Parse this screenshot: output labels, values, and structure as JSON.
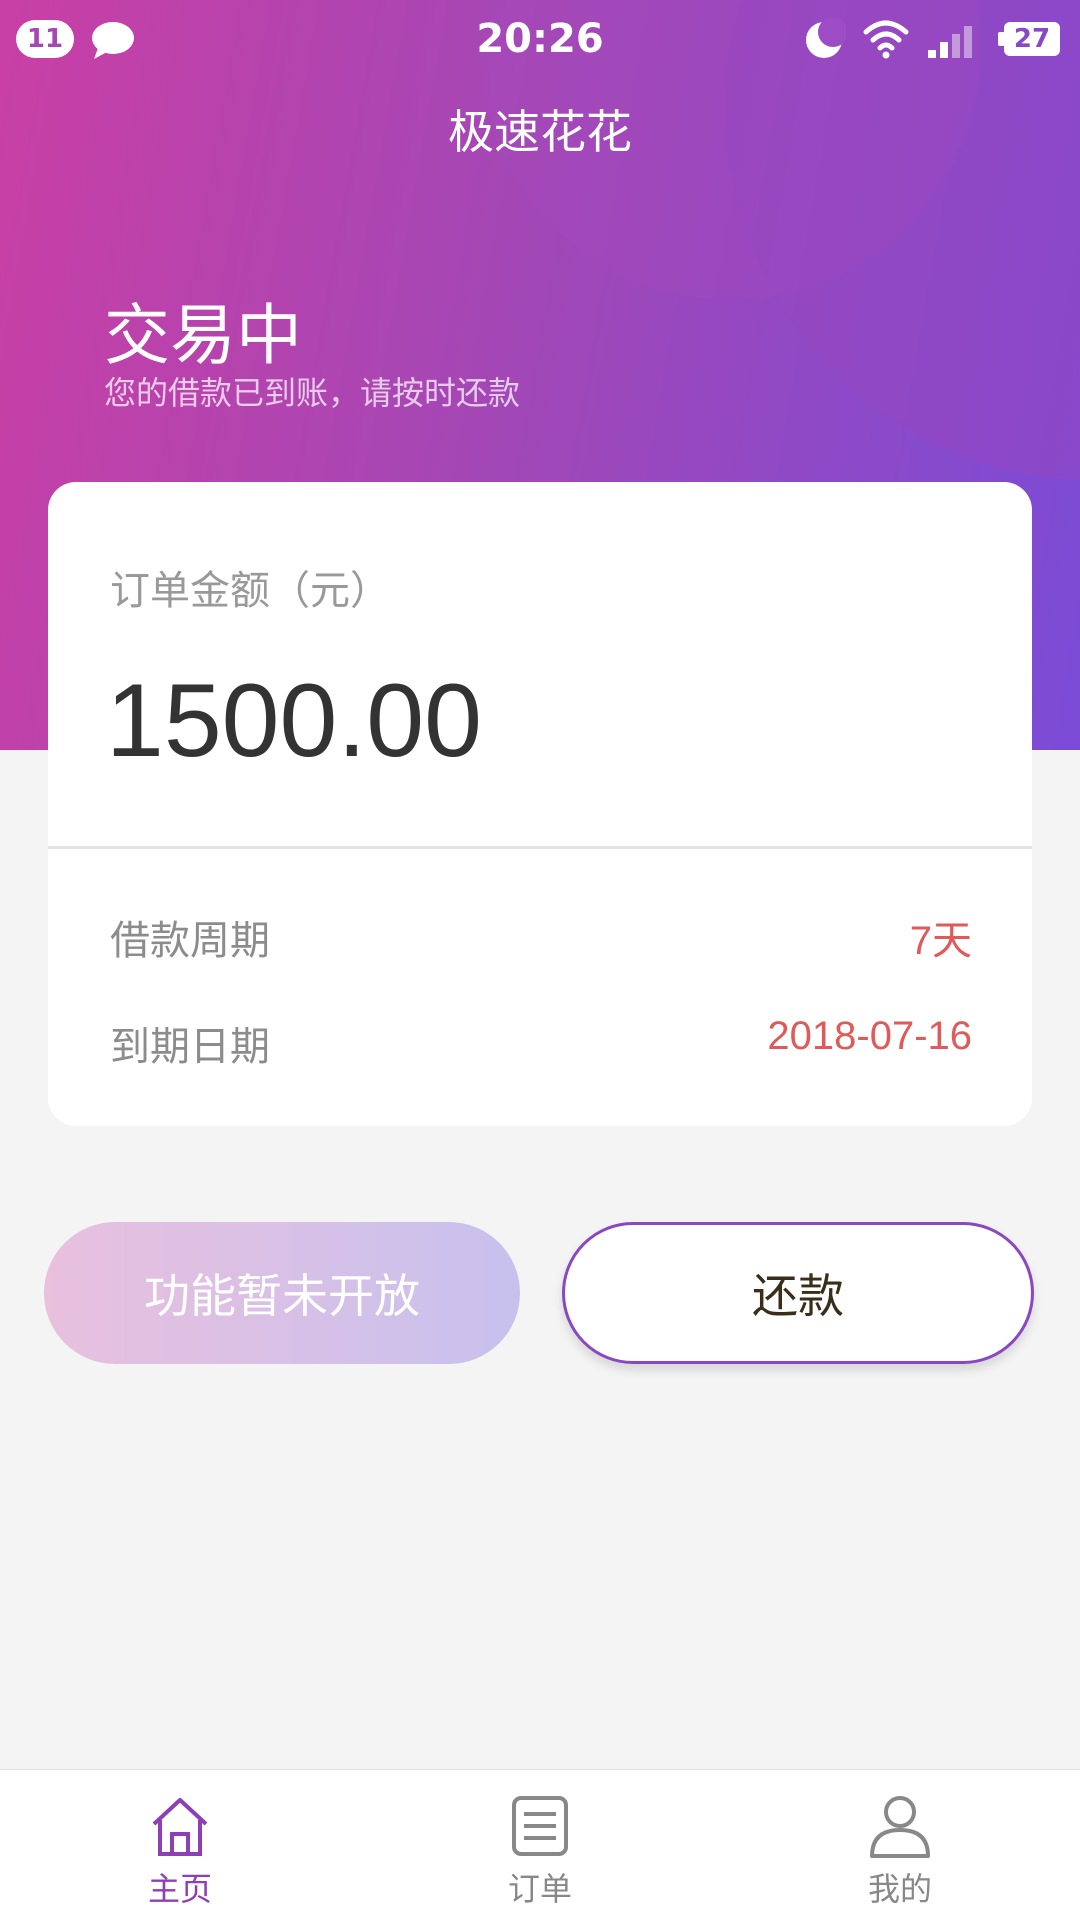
{
  "status_bar": {
    "notification_count": "11",
    "time": "20:26",
    "battery": "27",
    "icons": [
      "chat-icon",
      "moon-icon",
      "wifi-icon",
      "signal-icon"
    ]
  },
  "header": {
    "app_title": "极速花花",
    "status_title": "交易中",
    "status_subtitle": "您的借款已到账，请按时还款"
  },
  "order_card": {
    "amount_label": "订单金额（元）",
    "amount_value": "1500.00",
    "period_label": "借款周期",
    "period_value": "7天",
    "due_label": "到期日期",
    "due_value": "2018-07-16"
  },
  "actions": {
    "disabled_label": "功能暂未开放",
    "repay_label": "还款"
  },
  "tabbar": {
    "items": [
      {
        "label": "主页",
        "icon": "home-icon",
        "active": true
      },
      {
        "label": "订单",
        "icon": "document-icon",
        "active": false
      },
      {
        "label": "我的",
        "icon": "user-icon",
        "active": false
      }
    ]
  },
  "colors": {
    "header_gradient_start": "#c93fa5",
    "header_gradient_end": "#7b4bd6",
    "accent_red": "#e05a5a",
    "active_tab": "#8e3fb6",
    "repay_border": "#8a48c0"
  }
}
